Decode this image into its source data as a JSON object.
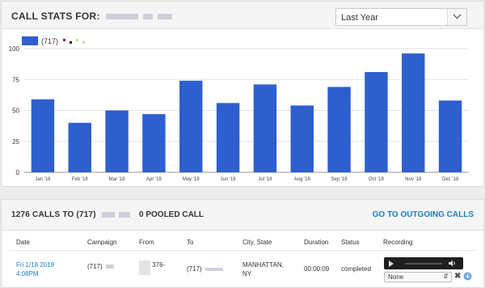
{
  "stats_panel": {
    "title": "CALL STATS FOR:",
    "period": "Last Year"
  },
  "colors": {
    "bar": "#2e5fcf",
    "link": "#1a7fc4"
  },
  "chart_data": {
    "type": "bar",
    "categories": [
      "Jan '18",
      "Feb '18",
      "Mar '18",
      "Apr '18",
      "May '18",
      "Jun '18",
      "Jul '18",
      "Aug '18",
      "Sep '18",
      "Oct '18",
      "Nov '18",
      "Dec '18"
    ],
    "series": [
      {
        "name": "(717)",
        "values": [
          59,
          40,
          50,
          47,
          74,
          56,
          71,
          54,
          69,
          81,
          96,
          58
        ]
      }
    ],
    "yticks": [
      0,
      25,
      50,
      75,
      100
    ],
    "ylim": [
      0,
      100
    ],
    "grid": true,
    "legend": "top-left"
  },
  "calls_panel": {
    "title": "1276 CALLS TO (717)",
    "pooled": "0 POOLED CALL",
    "outgoing_link": "GO TO OUTGOING CALLS",
    "columns": [
      "Date",
      "Campaign",
      "From",
      "To",
      "City, State",
      "Duration",
      "Status",
      "Recording"
    ],
    "rows": [
      {
        "date_line1": "Fri 1/18 2019",
        "date_line2": "4:08PM",
        "campaign": "(717)",
        "from": "376-",
        "to": "(717)",
        "city_line1": "MANHATTAN,",
        "city_line2": "NY",
        "duration": "00:00:09",
        "status": "completed",
        "recording_option": "None"
      }
    ]
  },
  "icons": {
    "dropdown": "chevron-down-icon",
    "play": "play-icon",
    "volume": "volume-icon",
    "delete": "close-icon",
    "download": "download-icon"
  }
}
